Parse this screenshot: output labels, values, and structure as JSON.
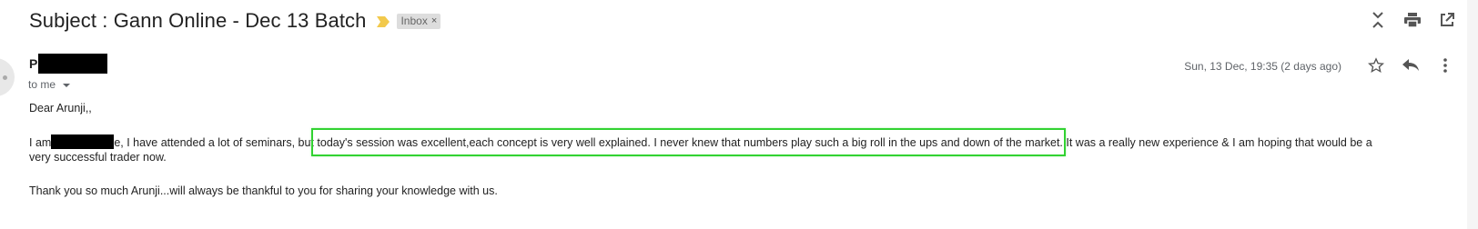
{
  "email": {
    "subject": "Subject : Gann Online - Dec 13 Batch",
    "label": "Inbox",
    "label_close": "×",
    "sender_initial": "P",
    "recipient": "to me",
    "date": "Sun, 13 Dec, 19:35 (2 days ago)",
    "greeting": "Dear Arunji,,",
    "para1_prefix": "I am",
    "para1_after_redaction": "e, I have attended a lot of seminars, but",
    "para1_highlighted": "today's session was excellent,each concept is very well explained. I never knew that numbers  play such a big roll in the ups and down of the market.",
    "para1_suffix": "It was a really new experience & I am hoping  that would be a",
    "para1_line2": "very successful trader now.",
    "para2": "Thank you so much Arunji...will always be thankful to you for sharing your knowledge with us."
  },
  "colors": {
    "highlight_border": "#32d232",
    "importance_marker": "#f2c94c",
    "redaction": "#000000"
  },
  "icons": {
    "top_actions": [
      "collapse-all-icon",
      "print-icon",
      "open-in-new-window-icon"
    ],
    "message_actions": [
      "star-icon",
      "reply-icon",
      "more-vert-icon"
    ],
    "importance": "importance-marker-icon"
  }
}
